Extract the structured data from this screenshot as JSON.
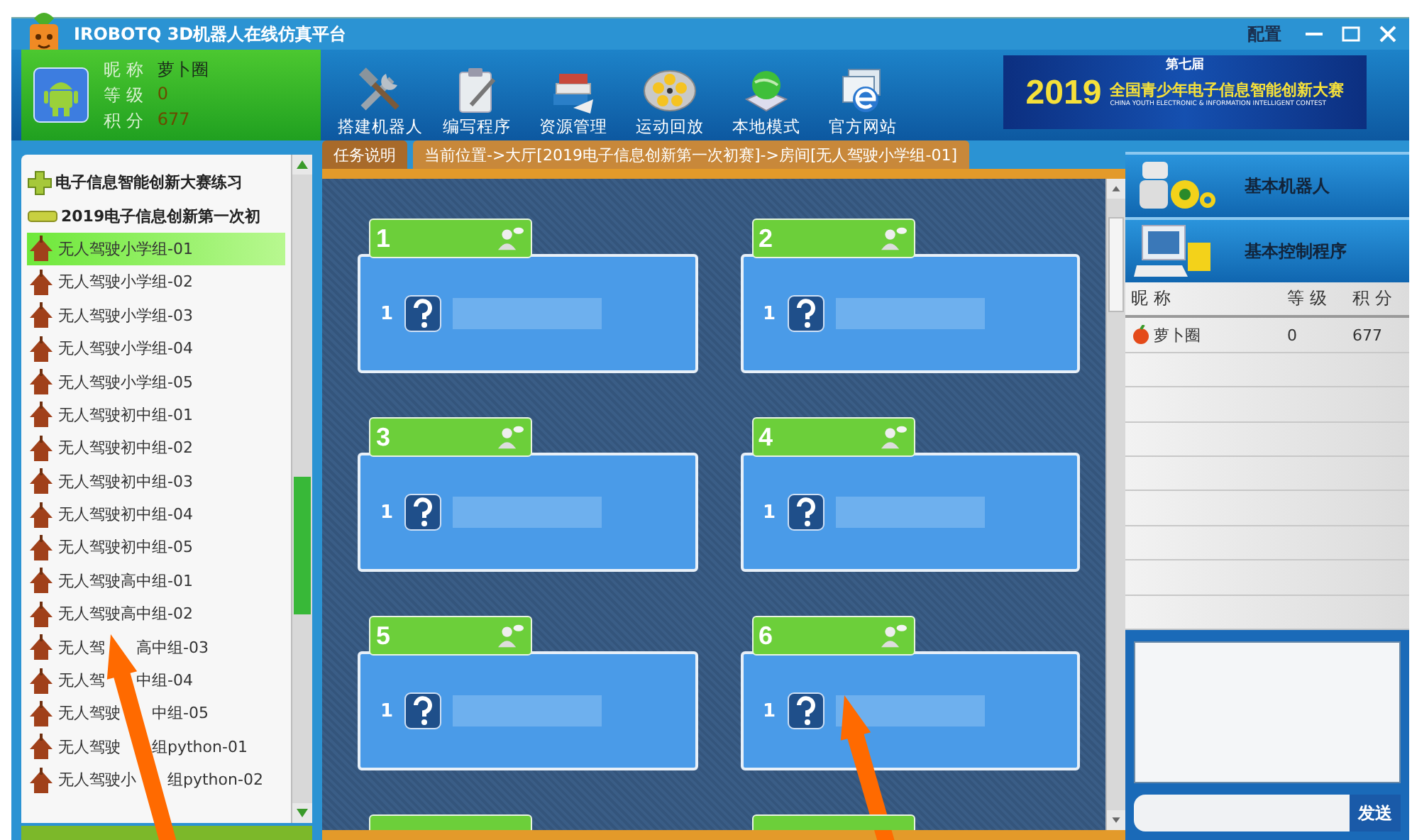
{
  "window": {
    "title": "IROBOTQ  3D机器人在线仿真平台",
    "controls": [
      "配置"
    ]
  },
  "user": {
    "fields": [
      {
        "label": "昵 称",
        "value": "萝卜圈"
      },
      {
        "label": "等 级",
        "value": "0"
      },
      {
        "label": "积 分",
        "value": "677"
      }
    ]
  },
  "toolbar": [
    {
      "label": "搭建机器人",
      "kind": "tools"
    },
    {
      "label": "编写程序",
      "kind": "clipboard"
    },
    {
      "label": "资源管理",
      "kind": "books"
    },
    {
      "label": "运动回放",
      "kind": "reel"
    },
    {
      "label": "本地模式",
      "kind": "globe"
    },
    {
      "label": "官方网站",
      "kind": "browser"
    }
  ],
  "banner": {
    "edition": "第七届",
    "year": "2019",
    "title": "全国青少年电子信息智能创新大赛",
    "subtitle": "CHINA YOUTH ELECTRONIC & INFORMATION INTELLIGENT CONTEST"
  },
  "sidebar": {
    "tree": [
      {
        "label": "电子信息智能创新大赛练习",
        "children": [
          {
            "label": "2019电子信息创新第一次初",
            "children": [
              {
                "label": "无人驾驶小学组-01",
                "selected": true
              },
              {
                "label": "无人驾驶小学组-02",
                "selected": false
              },
              {
                "label": "无人驾驶小学组-03",
                "selected": false
              },
              {
                "label": "无人驾驶小学组-04",
                "selected": false
              },
              {
                "label": "无人驾驶小学组-05",
                "selected": false
              },
              {
                "label": "无人驾驶初中组-01",
                "selected": false
              },
              {
                "label": "无人驾驶初中组-02",
                "selected": false
              },
              {
                "label": "无人驾驶初中组-03",
                "selected": false
              },
              {
                "label": "无人驾驶初中组-04",
                "selected": false
              },
              {
                "label": "无人驾驶初中组-05",
                "selected": false
              },
              {
                "label": "无人驾驶高中组-01",
                "selected": false
              },
              {
                "label": "无人驾驶高中组-02",
                "selected": false
              },
              {
                "label_parts": [
                  "无人驾",
                  "高中组-03"
                ],
                "selected": false
              },
              {
                "label_parts": [
                  "无人驾",
                  "中组-04"
                ],
                "selected": false
              },
              {
                "label_parts": [
                  "无人驾驶",
                  "中组-05"
                ],
                "selected": false
              },
              {
                "label_parts": [
                  "无人驾驶",
                  "组python-01"
                ],
                "selected": false
              },
              {
                "label_parts": [
                  "无人驾驶小",
                  "组python-02"
                ],
                "selected": false
              }
            ]
          }
        ]
      }
    ]
  },
  "tabs": [
    {
      "label": "任务说明",
      "selected": true
    },
    {
      "label": "当前位置->大厅[2019电子信息创新第一次初赛]->房间[无人驾驶小学组-01]",
      "selected": false
    }
  ],
  "rooms": [
    {
      "number": "1",
      "seat": "1"
    },
    {
      "number": "2",
      "seat": "1"
    },
    {
      "number": "3",
      "seat": "1"
    },
    {
      "number": "4",
      "seat": "1"
    },
    {
      "number": "5",
      "seat": "1"
    },
    {
      "number": "6",
      "seat": "1"
    },
    {
      "partial": true
    },
    {
      "partial": true
    }
  ],
  "side_buttons": [
    {
      "label": "基本机器人",
      "kind": "robot"
    },
    {
      "label": "基本控制程序",
      "kind": "computer"
    }
  ],
  "players": {
    "columns": [
      "昵 称",
      "等 级",
      "积 分"
    ],
    "rows": [
      {
        "name": "萝卜圈",
        "level": "0",
        "score": "677"
      }
    ]
  },
  "chat": {
    "send": "发送"
  }
}
